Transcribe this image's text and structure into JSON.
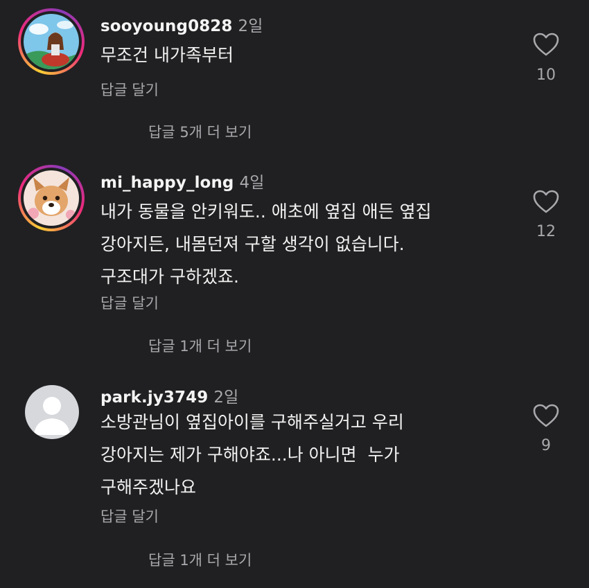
{
  "comments": [
    {
      "username": "sooyoung0828",
      "time": "2일",
      "lines": [
        "무조건 내가족부터"
      ],
      "reply_label": "답글 달기",
      "view_replies": "답글 5개 더 보기",
      "likes": "10",
      "avatar": "profile-photo"
    },
    {
      "username": "mi_happy_long",
      "time": "4일",
      "lines": [
        "내가 동물을 안키워도.. 애초에 옆집 애든 옆집",
        "강아지든, 내몸던져 구할 생각이 없습니다.",
        "구조대가 구하겠죠."
      ],
      "reply_label": "답글 달기",
      "view_replies": "답글 1개 더 보기",
      "likes": "12",
      "avatar": "dog-photo"
    },
    {
      "username": "park.jy3749",
      "time": "2일",
      "lines": [
        "소방관님이 옆집아이를 구해주실거고 우리",
        "강아지는 제가 구해야죠...나 아니면  누가",
        "구해주겠나요"
      ],
      "reply_label": "답글 달기",
      "view_replies": "답글 1개 더 보기",
      "likes": "9",
      "avatar": "default-user-icon"
    }
  ],
  "colors": {
    "background": "#202022",
    "primary_text": "#f2f2f2",
    "secondary_text": "#a9a9ad",
    "story_ring": [
      "#f9ce34",
      "#ee2a7b",
      "#8a3ab9"
    ]
  }
}
